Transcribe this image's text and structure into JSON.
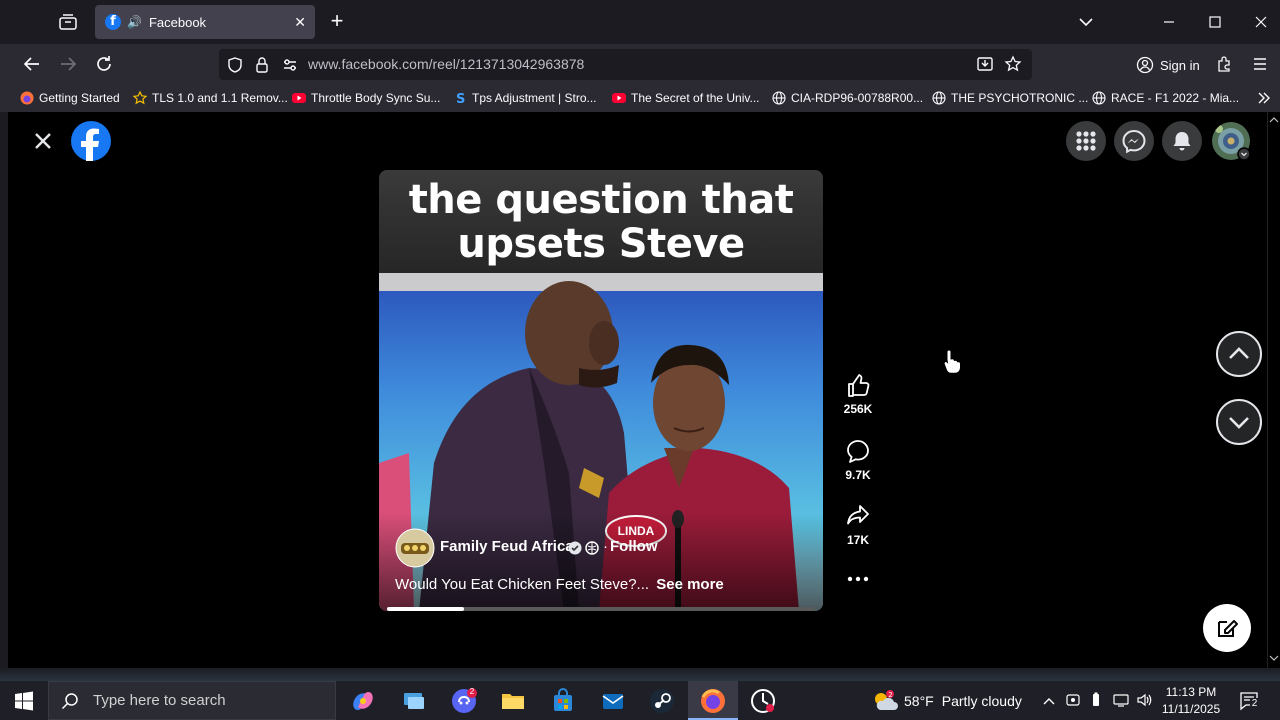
{
  "browser": {
    "tab": {
      "title": "Facebook"
    },
    "url": "www.facebook.com/reel/1213713042963878",
    "signin_label": "Sign in",
    "bookmarks": [
      "Getting Started",
      "TLS 1.0 and 1.1 Remov...",
      "Throttle Body Sync Su...",
      "Tps Adjustment | Stro...",
      "The Secret of the Univ...",
      "CIA-RDP96-00788R00...",
      "THE PSYCHOTRONIC ...",
      "RACE - F1 2022 - Mia..."
    ]
  },
  "reel": {
    "caption_line1": "the question that",
    "caption_line2": "upsets Steve",
    "name_tag": "LINDA",
    "page_name": "Family Feud Africa",
    "follow_label": "Follow",
    "description": "Would You Eat Chicken Feet Steve?...",
    "see_more": "See more",
    "progress": 0.18,
    "likes": "256K",
    "comments": "9.7K",
    "shares": "17K"
  },
  "taskbar": {
    "search_placeholder": "Type here to search",
    "weather_temp": "58°F",
    "weather_desc": "Partly cloudy",
    "time": "11:13 PM",
    "date": "11/11/2025",
    "notif_count": "2",
    "chat_badge": "2"
  },
  "colors": {
    "facebook_blue": "#1877f2",
    "accent_red": "#d6203a"
  }
}
